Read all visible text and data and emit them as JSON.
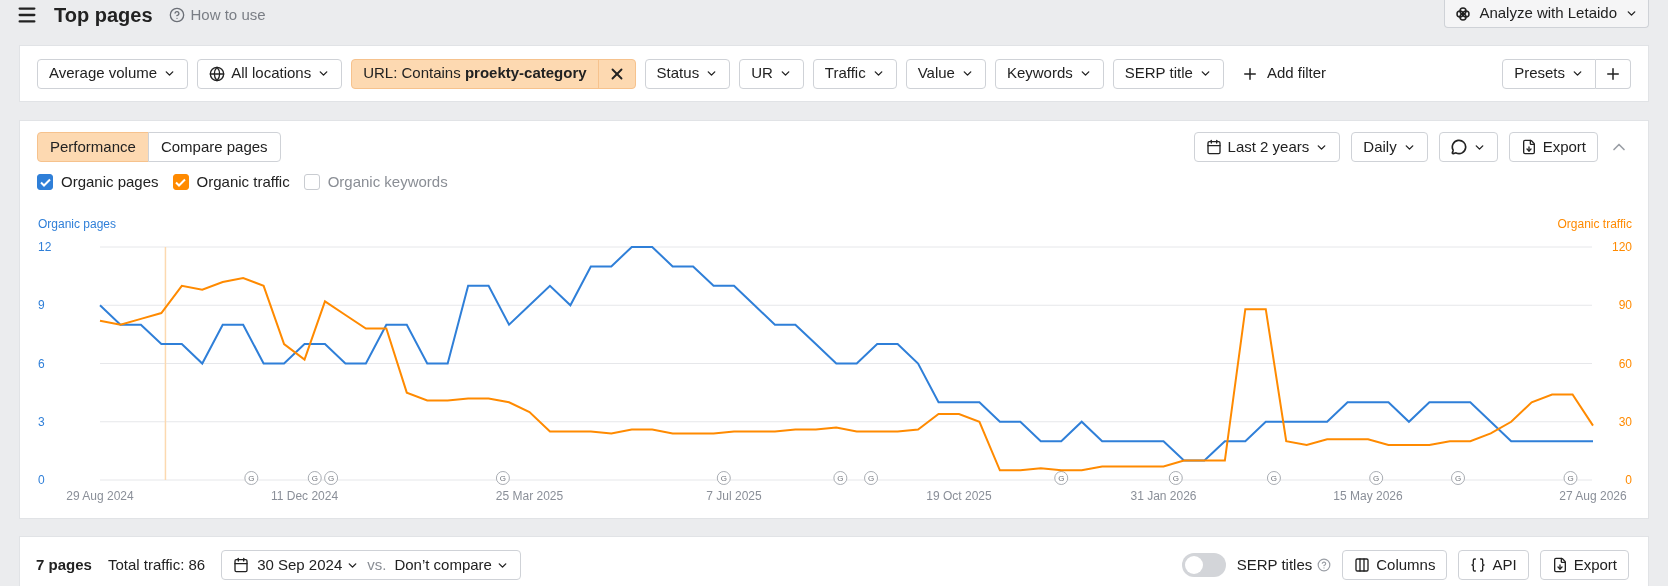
{
  "header": {
    "title": "Top pages",
    "help_link": "How to use",
    "ai_button": "Analyze with Letaido"
  },
  "filters": [
    {
      "kind": "dropdown",
      "label": "Average volume"
    },
    {
      "kind": "location",
      "label": "All locations"
    },
    {
      "kind": "active",
      "label": "URL: Contains **proekty-category**"
    },
    {
      "kind": "dropdown",
      "label": "Status"
    },
    {
      "kind": "dropdown",
      "label": "UR"
    },
    {
      "kind": "dropdown",
      "label": "Traffic"
    },
    {
      "kind": "dropdown",
      "label": "Value"
    },
    {
      "kind": "dropdown",
      "label": "Keywords"
    },
    {
      "kind": "dropdown",
      "label": "SERP title"
    },
    {
      "kind": "add",
      "label": "Add filter"
    }
  ],
  "presets": "Presets",
  "performance": {
    "tabs": [
      {
        "label": "Performance",
        "selected": true
      },
      {
        "label": "Compare pages",
        "selected": false
      }
    ],
    "date_range": "Last 2 years",
    "interval": "Daily",
    "export": "Export",
    "expanded": true,
    "metrics": [
      {
        "label": "Organic pages",
        "checked": true,
        "color": "#2f7fd8"
      },
      {
        "label": "Organic traffic",
        "checked": true,
        "color": "#ff8a00"
      },
      {
        "label": "Organic keywords",
        "checked": false
      }
    ],
    "chart_data": {
      "type": "line",
      "ylim": [
        0,
        12
      ],
      "y2lim": [
        0,
        120
      ],
      "yticks": [
        0,
        3,
        6,
        9,
        12
      ],
      "y2ticks": [
        0,
        30,
        60,
        90,
        120
      ],
      "categories": [
        "29 Aug 2024",
        null,
        null,
        null,
        null,
        null,
        null,
        null,
        null,
        null,
        "11 Dec 2024",
        null,
        null,
        null,
        null,
        null,
        null,
        null,
        null,
        null,
        null,
        "25 Mar 2025",
        null,
        null,
        null,
        null,
        null,
        null,
        null,
        null,
        null,
        "7 Jul 2025",
        null,
        null,
        null,
        null,
        null,
        null,
        null,
        null,
        null,
        null,
        "19 Oct 2025",
        null,
        null,
        null,
        null,
        null,
        null,
        null,
        null,
        null,
        "31 Jan 2026",
        null,
        null,
        null,
        null,
        null,
        null,
        null,
        null,
        null,
        "15 May 2026",
        null,
        null,
        null,
        null,
        null,
        null,
        null,
        null,
        null,
        null,
        "27 Aug 2026"
      ],
      "series": [
        {
          "name": "Organic pages",
          "color": "#2f7fd8",
          "values": [
            9,
            8,
            8,
            7,
            7,
            6,
            8,
            8,
            6,
            6,
            7,
            7,
            6,
            6,
            8,
            8,
            6,
            6,
            10,
            10,
            8,
            9,
            10,
            9,
            11,
            11,
            12,
            12,
            11,
            11,
            10,
            10,
            9,
            8,
            8,
            7,
            6,
            6,
            7,
            7,
            6,
            4,
            4,
            4,
            3,
            3,
            2,
            2,
            3,
            2,
            2,
            2,
            2,
            1,
            1,
            2,
            2,
            3,
            3,
            3,
            3,
            4,
            4,
            4,
            3,
            4,
            4,
            4,
            3,
            2,
            2,
            2,
            2,
            2
          ]
        },
        {
          "name": "Organic traffic",
          "color": "#ff8a00",
          "axis": "y2",
          "values": [
            82,
            80,
            83,
            86,
            100,
            98,
            102,
            104,
            100,
            70,
            62,
            92,
            85,
            78,
            78,
            45,
            41,
            41,
            42,
            42,
            40,
            35,
            25,
            25,
            25,
            24,
            26,
            26,
            24,
            24,
            24,
            25,
            25,
            25,
            26,
            26,
            27,
            25,
            25,
            25,
            26,
            34,
            34,
            30,
            5,
            5,
            6,
            5,
            5,
            7,
            7,
            7,
            7,
            10,
            10,
            10,
            88,
            88,
            20,
            18,
            21,
            21,
            21,
            18,
            18,
            18,
            20,
            20,
            24,
            30,
            40,
            44,
            44,
            28
          ]
        }
      ],
      "grid": true
    },
    "update_markers": [
      "G",
      "G",
      "G",
      "G",
      "G",
      "G",
      "G",
      "G",
      "G",
      "G",
      "G",
      "G",
      "G"
    ]
  },
  "bottom": {
    "page_count": "7 pages",
    "total_traffic": "Total traffic: 86",
    "date": "30 Sep 2024",
    "vs": "vs.",
    "compare": "Don’t compare",
    "serp_toggle": {
      "label": "SERP titles",
      "on": false
    },
    "columns": "Columns",
    "api": "API",
    "export": "Export"
  }
}
